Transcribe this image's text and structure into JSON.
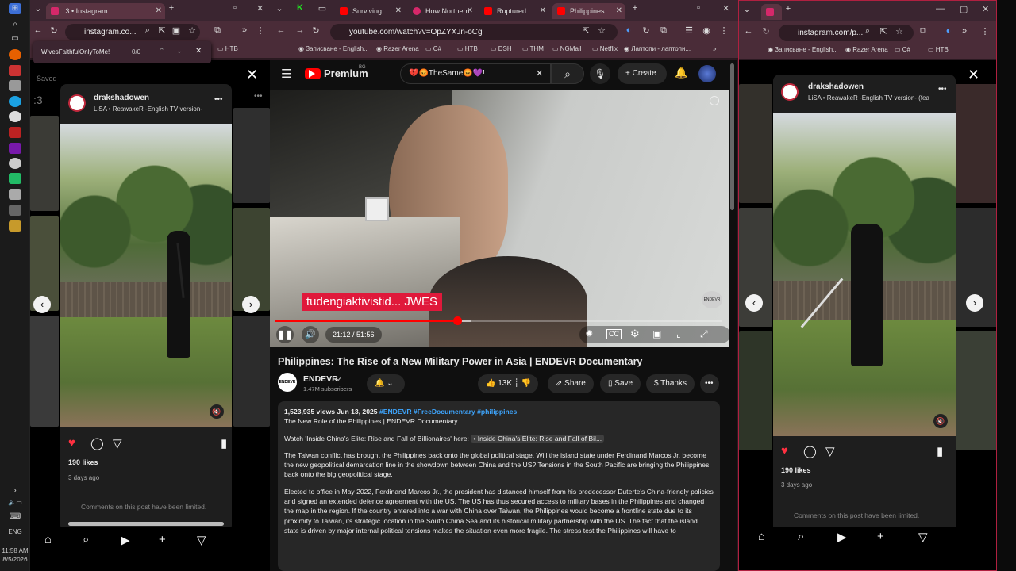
{
  "taskbar": {
    "time": "11:58 AM",
    "date": "8/5/2026",
    "lang": "ENG"
  },
  "left_window": {
    "tab_title": ":3 • Instagram",
    "url": "instagram.co...",
    "find_query": "WivesFaithfulOnlyToMe!",
    "find_count": "0/0",
    "bookmark": "HTB",
    "saved_label": "Saved",
    "post": {
      "username": "drakshadowen",
      "audio": "LiSA • ReawakeR -English TV version-",
      "likes": "190 likes",
      "time_ago": "3 days ago",
      "comments_note": "Comments on this post have been limited."
    }
  },
  "mid_window": {
    "tabs": [
      {
        "label": "Surviving"
      },
      {
        "label": "How Northern"
      },
      {
        "label": "Ruptured"
      },
      {
        "label": "Philippines"
      }
    ],
    "url": "youtube.com/watch?v=OpZYXJn-oCg",
    "bookmarks": [
      "Записване - English...",
      "Razer Arena",
      "C#",
      "HTB",
      "DSH",
      "THM",
      "NGMail",
      "Netflix",
      "Лаптопи - лаптопи..."
    ]
  },
  "youtube": {
    "logo": "Premium",
    "logo_sup": "BG",
    "search_value": "💔😡TheSame😡💜!",
    "create_label": "Create",
    "subtitle": "tudengiaktivistid... JWES",
    "watermark": "ENDEVR",
    "time_display": "21:12 / 51:56",
    "progress": 0.408,
    "buffered": 0.438,
    "title": "Philippines: The Rise of a New Military Power in Asia | ENDEVR Documentary",
    "channel": "ENDEVR",
    "subscribers": "1.47M subscribers",
    "likes": "13K",
    "share": "Share",
    "save": "Save",
    "thanks": "Thanks",
    "description": {
      "views_date": "1,523,935 views  Jun 13, 2025",
      "hashtags": "#ENDEVR #FreeDocumentary #philippines",
      "subtitle": "The New Role of the Philippines | ENDEVR Documentary",
      "watch_prefix": "Watch 'Inside China's Elite: Rise and Fall of Billionaires' here:",
      "watch_link": "• Inside China's Elite: Rise and Fall of Bil...",
      "para1": "The Taiwan conflict has brought the Philippines back onto the global political stage. Will the island state under Ferdinand Marcos Jr. become the new geopolitical demarcation line in the showdown between China and the US? Tensions in the South Pacific are bringing the Philippines back onto the big geopolitical stage.",
      "para2": "Elected to office in May 2022, Ferdinand Marcos Jr., the president has distanced himself from his predecessor Duterte's China-friendly policies and signed an extended defence agreement with the US. The US has thus secured access to military bases in the Philippines and changed the map in the region. If the country entered into a war with China over Taiwan, the Philippines would become a frontline state due to its proximity to Taiwan, its strategic location in the South China Sea and its historical military partnership with the US. The fact that the island state is driven by major internal political tensions makes the situation even more fragile. The stress test the Philippines will have to"
    }
  },
  "right_window": {
    "url": "instagram.com/p...",
    "bookmarks": [
      "Записване - English...",
      "Razer Arena",
      "C#",
      "HTB"
    ],
    "post": {
      "username": "drakshadowen",
      "audio": "LiSA • ReawakeR -English TV version- (fea",
      "likes": "190 likes",
      "time_ago": "3 days ago",
      "comments_note": "Comments on this post have been limited."
    }
  },
  "colors": {
    "accent_red": "#ff0000",
    "insta_like": "#ff3040",
    "link_blue": "#3ea6ff",
    "window_frame": "#4a2c38"
  }
}
